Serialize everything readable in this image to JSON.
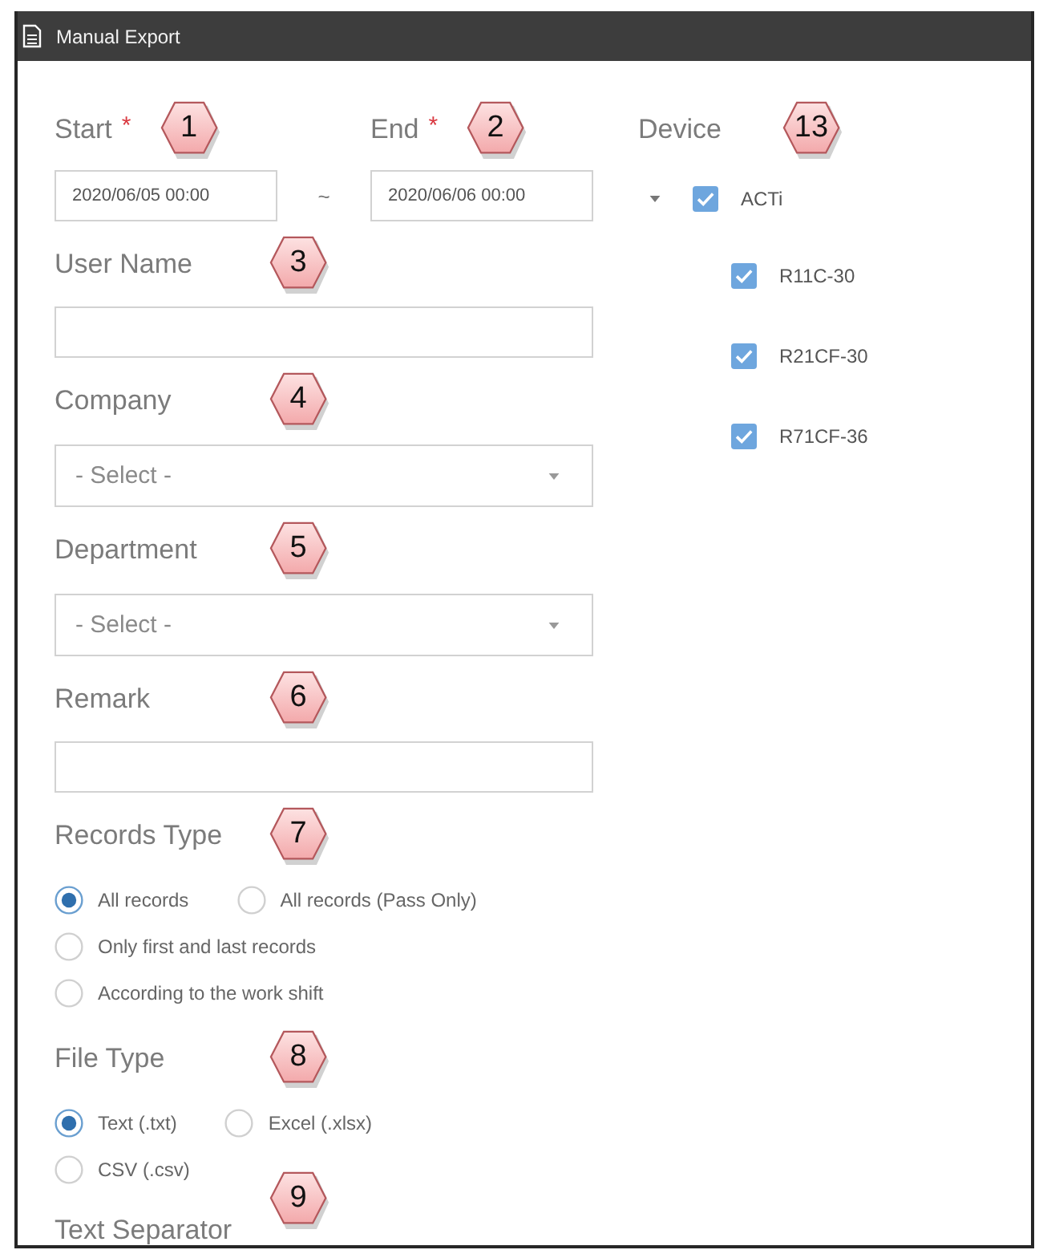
{
  "window": {
    "title": "Manual Export"
  },
  "date_range": {
    "start": {
      "label": "Start",
      "required_mark": "*",
      "callout": "1",
      "value": "2020/06/05 00:00"
    },
    "separator": "~",
    "end": {
      "label": "End",
      "required_mark": "*",
      "callout": "2",
      "value": "2020/06/06 00:00"
    }
  },
  "device": {
    "label": "Device",
    "callout": "13",
    "tree": [
      {
        "label": "ACTi",
        "checked": true,
        "expanded": true,
        "children": [
          {
            "label": "R11C-30",
            "checked": true
          },
          {
            "label": "R21CF-30",
            "checked": true
          },
          {
            "label": "R71CF-36",
            "checked": true
          }
        ]
      }
    ]
  },
  "fields": [
    {
      "kind": "text",
      "label": "User Name",
      "callout": "3"
    },
    {
      "kind": "select",
      "label": "Company",
      "callout": "4",
      "placeholder": "- Select -"
    },
    {
      "kind": "select",
      "label": "Department",
      "callout": "5",
      "placeholder": "- Select -"
    },
    {
      "kind": "text",
      "label": "Remark",
      "callout": "6"
    },
    {
      "kind": "radio",
      "label": "Records Type",
      "callout": "7",
      "options": [
        {
          "label": "All records",
          "selected": true
        },
        {
          "label": "All records (Pass Only)",
          "selected": false
        },
        {
          "label": "Only first and last records",
          "selected": false
        },
        {
          "label": "According to the work shift",
          "selected": false
        }
      ]
    },
    {
      "kind": "radio",
      "label": "File Type",
      "callout": "8",
      "options": [
        {
          "label": "Text (.txt)",
          "selected": true
        },
        {
          "label": "Excel (.xlsx)",
          "selected": false
        },
        {
          "label": "CSV (.csv)",
          "selected": false
        }
      ]
    },
    {
      "kind": "heading",
      "label": "Text Separator",
      "callout": "9"
    }
  ]
}
